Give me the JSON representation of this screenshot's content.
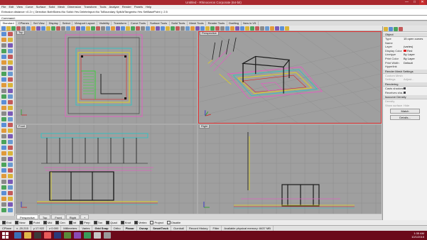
{
  "window": {
    "title": "Untitled - Rhinoceros Corporate (64-bit)",
    "buttons": [
      "—",
      "□",
      "✕"
    ]
  },
  "menu": [
    "File",
    "Edit",
    "View",
    "Curve",
    "Surface",
    "Solid",
    "Mesh",
    "Dimension",
    "Transform",
    "Tools",
    "Analyze",
    "Render",
    "Panels",
    "Help"
  ],
  "command": {
    "history": "Extrusion distance <0.2> ( Direction BothSides=No Solid=Yes DeleteInput=No ToBoundary SplitAtTangents=Yes SetBasePoint ): 2.5",
    "prompt": "Command:"
  },
  "toolbar_tabs": {
    "items": [
      "Standard",
      "CPlanes",
      "Set View",
      "Display",
      "Select",
      "Viewport Layout",
      "Visibility",
      "Transform",
      "Curve Tools",
      "Surface Tools",
      "Solid Tools",
      "Mesh Tools",
      "Render Tools",
      "Drafting",
      "New in V5"
    ],
    "active": "Standard"
  },
  "viewports": {
    "top": "Top",
    "perspective": "Perspective",
    "front": "Front",
    "right": "Right"
  },
  "viewport_tabs": {
    "items": [
      "Perspective",
      "Top",
      "Front",
      "Right"
    ],
    "active": "Perspective",
    "add_icon": "+"
  },
  "properties": {
    "object_header": "Object",
    "rows": [
      {
        "k": "Type",
        "v": "15 open curves"
      },
      {
        "k": "Name",
        "v": ""
      },
      {
        "k": "Layer",
        "v": "(varies)"
      },
      {
        "k": "Display Color",
        "v": "Red",
        "swatch": "#e02020"
      },
      {
        "k": "Linetype",
        "v": "By Layer"
      },
      {
        "k": "Print Color",
        "v": "By Layer"
      },
      {
        "k": "Print Width",
        "v": "Default"
      },
      {
        "k": "Hyperlink",
        "v": ""
      }
    ],
    "mesh_header": "Render Mesh Settings",
    "mesh_rows": [
      {
        "k": "Custom Mesh",
        "v": ""
      },
      {
        "k": "Settings",
        "v": "Adjust..."
      }
    ],
    "rendering_header": "Rendering",
    "rendering_rows": [
      {
        "k": "Casts shadows",
        "v": "check"
      },
      {
        "k": "Receives sha...",
        "v": "check"
      }
    ],
    "density_header": "Isocurve Density",
    "density_rows": [
      {
        "k": "Density",
        "v": ""
      },
      {
        "k": "Show surface",
        "v": "Hide"
      }
    ],
    "buttons": [
      "Match",
      "Details..."
    ]
  },
  "osnap": {
    "items": [
      "End",
      "Near",
      "Point",
      "Mid",
      "Cen",
      "Int",
      "Perp",
      "Tan",
      "Quad",
      "Knot",
      "Vertex",
      "Project",
      "Disable"
    ],
    "checked": [
      "End",
      "Near",
      "Point",
      "Mid",
      "Cen",
      "Int",
      "Perp",
      "Tan",
      "Quad",
      "Knot",
      "Vertex"
    ]
  },
  "status": {
    "items": [
      "CPlane",
      "x -20.215",
      "y 17.922",
      "z 0.000",
      "Millimeters",
      "Varies"
    ],
    "modes": [
      "Grid Snap",
      "Ortho",
      "Planar",
      "Osnap",
      "SmartTrack",
      "Gumball",
      "Record History",
      "Filter"
    ],
    "bold_modes": [
      "Grid Snap",
      "Planar",
      "Osnap",
      "SmartTrack"
    ],
    "memory": "Available physical memory: 8437 MB"
  },
  "clock": {
    "time": "1:35 AM",
    "date": "10/1/2015"
  },
  "colors": {
    "titlebar": "#a9282f",
    "taskbar": "#6b0a1a",
    "viewport_bg": "#9f9f9f",
    "active_border": "#e03030"
  }
}
